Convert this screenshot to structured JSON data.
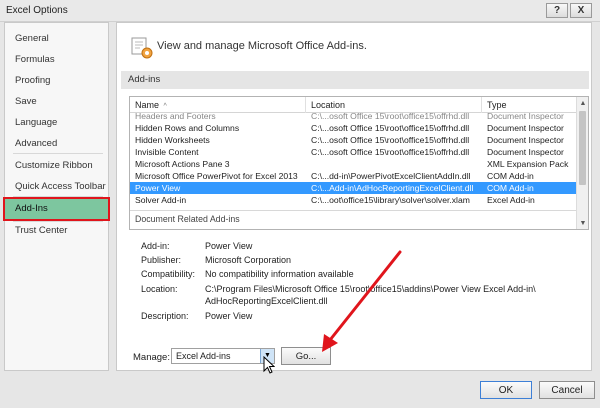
{
  "window": {
    "title": "Excel Options",
    "help_label": "?",
    "close_label": "X"
  },
  "sidebar": {
    "items": [
      {
        "label": "General"
      },
      {
        "label": "Formulas"
      },
      {
        "label": "Proofing"
      },
      {
        "label": "Save"
      },
      {
        "label": "Language"
      },
      {
        "label": "Advanced"
      },
      {
        "label": "Customize Ribbon"
      },
      {
        "label": "Quick Access Toolbar"
      },
      {
        "label": "Add-Ins"
      },
      {
        "label": "Trust Center"
      }
    ],
    "selected": "Add-Ins"
  },
  "main": {
    "header_text": "View and manage Microsoft Office Add-ins.",
    "section_title": "Add-ins",
    "columns": {
      "name": "Name",
      "location": "Location",
      "type": "Type",
      "sort_indicator": "^"
    },
    "rows": [
      {
        "name": "Headers and Footers",
        "location": "C:\\...osoft Office 15\\root\\office15\\offrhd.dll",
        "type": "Document Inspector"
      },
      {
        "name": "Hidden Rows and Columns",
        "location": "C:\\...osoft Office 15\\root\\office15\\offrhd.dll",
        "type": "Document Inspector"
      },
      {
        "name": "Hidden Worksheets",
        "location": "C:\\...osoft Office 15\\root\\office15\\offrhd.dll",
        "type": "Document Inspector"
      },
      {
        "name": "Invisible Content",
        "location": "C:\\...osoft Office 15\\root\\office15\\offrhd.dll",
        "type": "Document Inspector"
      },
      {
        "name": "Microsoft Actions Pane 3",
        "location": "",
        "type": "XML Expansion Pack"
      },
      {
        "name": "Microsoft Office PowerPivot for Excel 2013",
        "location": "C:\\...dd-in\\PowerPivotExcelClientAddIn.dll",
        "type": "COM Add-in"
      },
      {
        "name": "Power View",
        "location": "C:\\...Add-in\\AdHocReportingExcelClient.dll",
        "type": "COM Add-in"
      },
      {
        "name": "Solver Add-in",
        "location": "C:\\...oot\\office15\\library\\solver\\solver.xlam",
        "type": "Excel Add-in"
      }
    ],
    "selected_row": "Power View",
    "group_label": "Document Related Add-ins",
    "details": {
      "addin_label": "Add-in:",
      "addin_value": "Power View",
      "publisher_label": "Publisher:",
      "publisher_value": "Microsoft Corporation",
      "compat_label": "Compatibility:",
      "compat_value": "No compatibility information available",
      "location_label": "Location:",
      "location_value_line1": "C:\\Program Files\\Microsoft Office 15\\root\\office15\\addins\\Power View Excel Add-in\\",
      "location_value_line2": "AdHocReportingExcelClient.dll",
      "description_label": "Description:",
      "description_value": "Power View"
    },
    "manage_label": "Manage:",
    "manage_value": "Excel Add-ins",
    "go_label": "Go..."
  },
  "footer": {
    "ok_label": "OK",
    "cancel_label": "Cancel"
  },
  "colors": {
    "selected_sidebar": "#7dc69f",
    "highlight_outline": "#e0151c",
    "selected_row": "#3399ff",
    "arrow": "#e0151c"
  },
  "icons": [
    "addins-gear-icon",
    "dropdown-arrow-icon",
    "mouse-cursor-icon",
    "annotation-arrow-icon"
  ]
}
